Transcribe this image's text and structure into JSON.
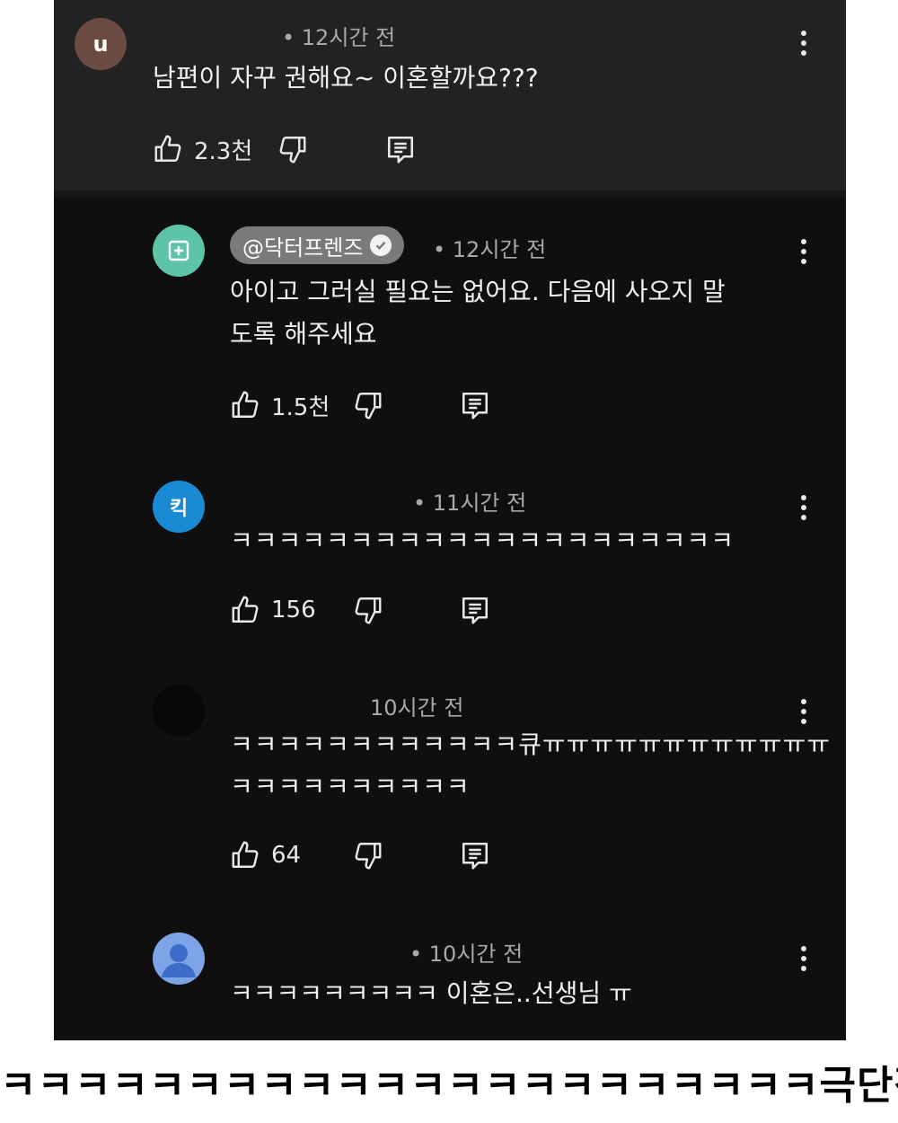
{
  "colors": {
    "background": "#0f0f0f",
    "top_comment_bg": "#222222",
    "text": "#f0f0f0",
    "muted": "#a8a8a8",
    "channel_pill": "#7a7a7a"
  },
  "comments": [
    {
      "avatar_letter": "u",
      "avatar_color": "#6b4a42",
      "time": "• 12시간 전",
      "text_lines": [
        "남편이 자꾸 권해요~ 이혼할까요???"
      ],
      "likes": "2.3천"
    },
    {
      "channel": "@닥터프렌즈",
      "verified": true,
      "avatar_color": "#5ec4a8",
      "time": "• 12시간 전",
      "text_lines": [
        "아이고 그러실 필요는 없어요. 다음에 사오지 말",
        "도록 해주세요"
      ],
      "likes": "1.5천"
    },
    {
      "avatar_letter": "킥",
      "avatar_color": "#1a8ad4",
      "time": "• 11시간 전",
      "text_lines": [
        "ㅋㅋㅋㅋㅋㅋㅋㅋㅋㅋㅋㅋㅋㅋㅋㅋㅋㅋㅋㅋㅋ"
      ],
      "likes": "156"
    },
    {
      "avatar_color": "#080808",
      "time": "10시간 전",
      "text_lines": [
        "ㅋㅋㅋㅋㅋㅋㅋㅋㅋㅋㅋㅋ큐ㅠㅠㅠㅠㅠㅠㅠㅠㅠㅠㅠㅠ",
        "ㅋㅋㅋㅋㅋㅋㅋㅋㅋㅋ"
      ],
      "likes": "64"
    },
    {
      "avatar_icon": "person-icon",
      "avatar_color": "#7da4e6",
      "time": "• 10시간 전",
      "text_lines": [
        "ㅋㅋㅋㅋㅋㅋㅋㅋㅋ 이혼은..선생님 ㅠ"
      ]
    }
  ],
  "caption": "ㅋㅋㅋㅋㅋㅋㅋㅋㅋㅋㅋㅋㅋㅋㅋㅋㅋㅋㅋㅋㅋㅋ극단적"
}
